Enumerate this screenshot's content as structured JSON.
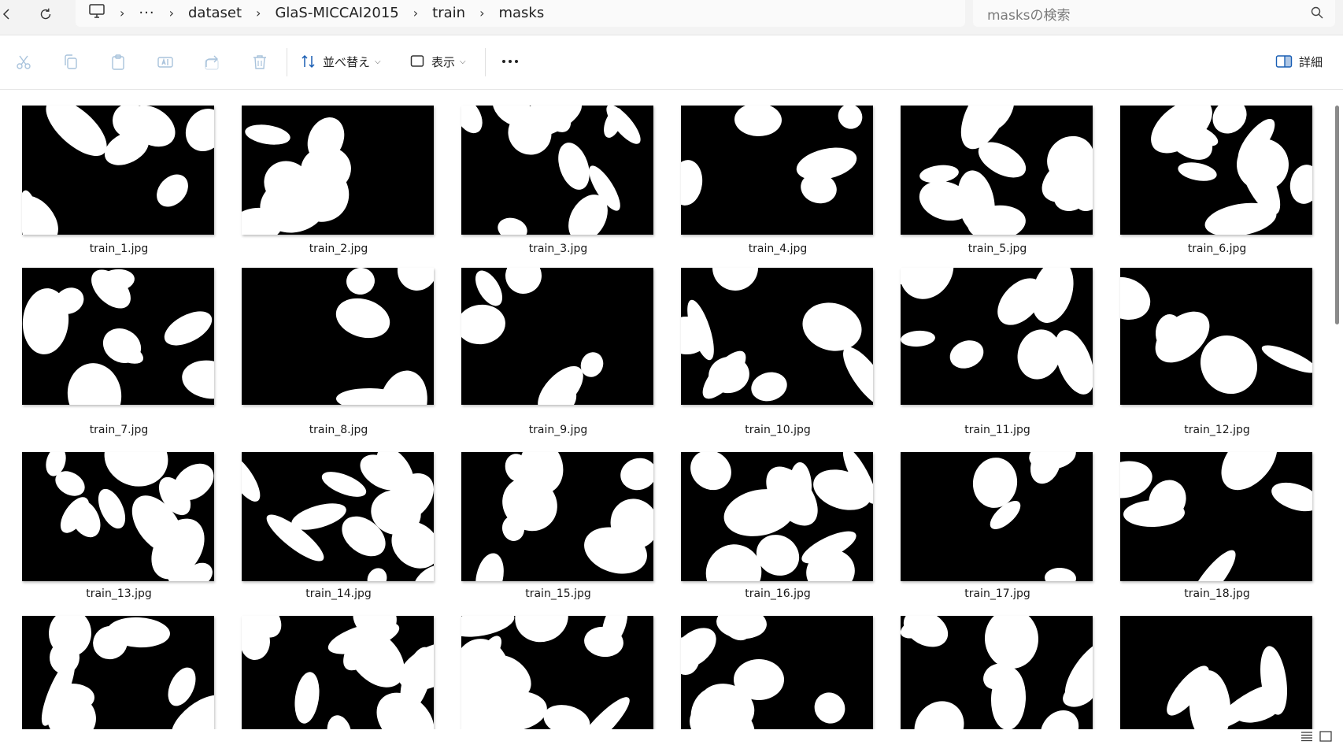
{
  "breadcrumb": {
    "items": [
      "dataset",
      "GlaS-MICCAI2015",
      "train",
      "masks"
    ]
  },
  "search": {
    "placeholder": "masksの検索"
  },
  "commandbar": {
    "sort_label": "並べ替え",
    "view_label": "表示",
    "details_label": "詳細"
  },
  "files": [
    "train_1.jpg",
    "train_2.jpg",
    "train_3.jpg",
    "train_4.jpg",
    "train_5.jpg",
    "train_6.jpg",
    "train_7.jpg",
    "train_8.jpg",
    "train_9.jpg",
    "train_10.jpg",
    "train_11.jpg",
    "train_12.jpg",
    "train_13.jpg",
    "train_14.jpg",
    "train_15.jpg",
    "train_16.jpg",
    "train_17.jpg",
    "train_18.jpg",
    "",
    "",
    "",
    "",
    "",
    ""
  ],
  "icons": {
    "back": "back-arrow-icon",
    "refresh": "refresh-icon",
    "monitor": "monitor-icon",
    "more_path": "ellipsis-icon",
    "search": "search-icon",
    "cut": "scissors-icon",
    "copy": "copy-icon",
    "paste": "paste-icon",
    "rename": "rename-icon",
    "share": "share-icon",
    "delete": "trash-icon",
    "sort": "sort-icon",
    "view": "view-icon",
    "more": "more-icon",
    "details": "details-pane-icon"
  },
  "colors": {
    "mask_foreground": "#ffffff",
    "mask_background": "#000000",
    "scrollbar": "#8a8a8a"
  }
}
